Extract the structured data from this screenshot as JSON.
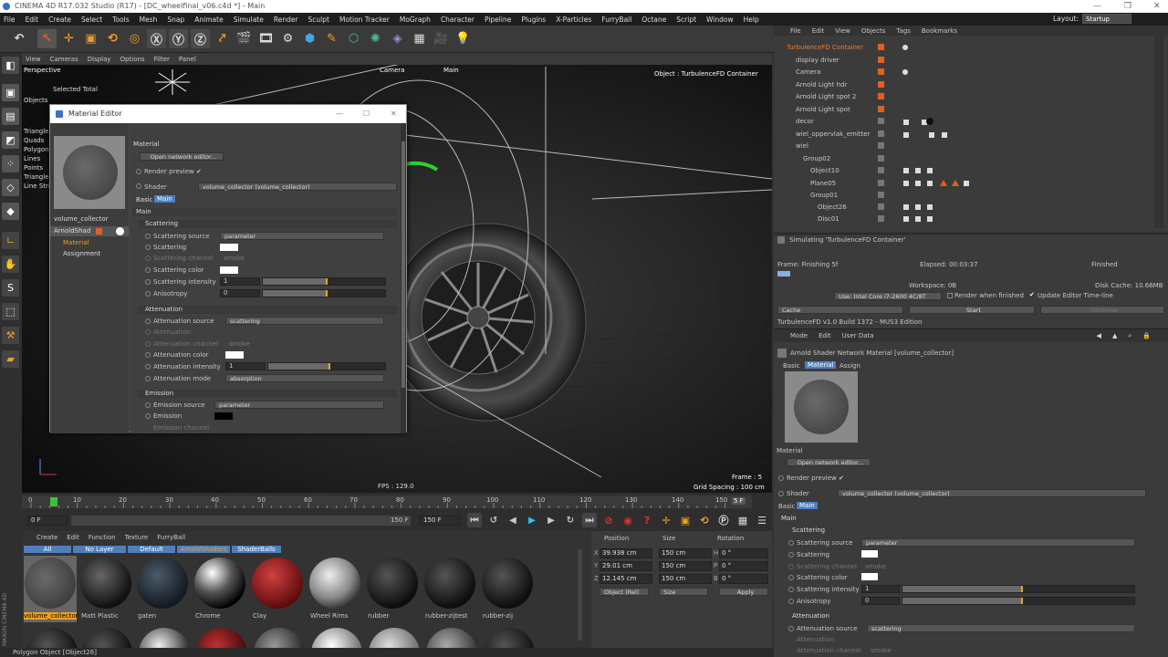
{
  "window": {
    "title": "CINEMA 4D R17.032 Studio (R17) - [DC_wheelfinal_v06.c4d *] - Main"
  },
  "menubar": [
    "File",
    "Edit",
    "Create",
    "Select",
    "Tools",
    "Mesh",
    "Snap",
    "Animate",
    "Simulate",
    "Render",
    "Sculpt",
    "Motion Tracker",
    "MoGraph",
    "Character",
    "Pipeline",
    "Plugins",
    "X-Particles",
    "FurryBall",
    "Octane",
    "Script",
    "Window",
    "Help"
  ],
  "layout": {
    "label": "Layout:",
    "value": "Startup"
  },
  "viewport": {
    "menu": [
      "View",
      "Cameras",
      "Display",
      "Options",
      "Filter",
      "Panel"
    ],
    "name": "Perspective",
    "camera": "Camera",
    "main_label": "Main",
    "object_label": "Object : TurbulenceFD Container",
    "fps": "FPS : 129.0",
    "frame": "Frame : 5",
    "grid": "Grid Spacing : 100 cm",
    "selected_total": "Selected Total",
    "objects_label": "Objects",
    "stats": [
      "Triangles",
      "Quads",
      "Polygons",
      "Lines",
      "Points",
      "Triangles",
      "Line Strips"
    ]
  },
  "mated": {
    "title": "Material Editor",
    "mat_name": "volume_collector",
    "channel_shader": "ArnoldShad",
    "channel_material": "Material",
    "channel_assign": "Assignment",
    "header": "Material",
    "open_network": "Open network editor...",
    "render_preview": "Render preview ✔",
    "shader_label": "Shader",
    "shader_value": "volume_collector (volume_collector)",
    "tab_basic": "Basic",
    "tab_main": "Main",
    "main_header": "Main",
    "scattering": {
      "title": "Scattering",
      "source_label": "Scattering source",
      "source_value": "parameter",
      "scattering_label": "Scattering",
      "channel_label": "Scattering channel",
      "channel_value": "smoke",
      "color_label": "Scattering color",
      "intensity_label": "Scattering intensity",
      "intensity_value": "1",
      "anisotropy_label": "Anisotropy",
      "anisotropy_value": "0"
    },
    "attenuation": {
      "title": "Attenuation",
      "source_label": "Attenuation source",
      "source_value": "scattering",
      "att_label": "Attenuation",
      "channel_label": "Attenuation channel",
      "channel_value": "smoke",
      "color_label": "Attenuation color",
      "intensity_label": "Attenuation intensity",
      "intensity_value": "1",
      "mode_label": "Attenuation mode",
      "mode_value": "absorption"
    },
    "emission": {
      "title": "Emission",
      "source_label": "Emission source",
      "source_value": "parameter",
      "emission_label": "Emission",
      "channel_label": "Emission channel"
    }
  },
  "objmgr": {
    "menu": [
      "File",
      "Edit",
      "View",
      "Objects",
      "Tags",
      "Bookmarks"
    ],
    "rows": [
      "TurbulenceFD Container",
      "display driver",
      "Camera",
      "Arnold Light hdr",
      "Arnold Light spot 2",
      "Arnold Light spot",
      "decor",
      "wiel_oppervlak_emitter",
      "wiel",
      "Group02",
      "Object10",
      "Plane05",
      "Group01",
      "Object26",
      "Disc01"
    ]
  },
  "sim": {
    "title": "Simulating 'TurbulenceFD Container'",
    "frame": "Frame: Finishing 5f",
    "elapsed": "Elapsed: 00:03:37",
    "finished": "Finished",
    "workspace": "Workspace: 0B",
    "disk_cache": "Disk Cache: 10.66MB",
    "cpu": "Use: Intel Core i7-2600 4C/8T",
    "render_when_finished": "Render when finished",
    "update_editor": "Update Editor Time-line",
    "cache": "Cache",
    "start": "Start",
    "continue": "Continue",
    "version": "TurbulenceFD v1.0 Build 1372 - MUS3 Edition"
  },
  "attr": {
    "menu": [
      "Mode",
      "Edit",
      "User Data"
    ],
    "title": "Arnold Shader Network Material [volume_collector]",
    "tabs": [
      "Basic",
      "Material",
      "Assign"
    ],
    "header": "Material",
    "open_network": "Open network editor...",
    "render_preview": "Render preview ✔",
    "shader_label": "Shader",
    "shader_value": "volume_collector (volume_collector)",
    "tab_basic": "Basic",
    "tab_main": "Main",
    "main_header": "Main",
    "scattering_title": "Scattering",
    "source_label": "Scattering source",
    "source_value": "parameter",
    "scattering_label": "Scattering",
    "channel_label": "Scattering channel",
    "channel_value": "smoke",
    "color_label": "Scattering color",
    "intensity_label": "Scattering intensity",
    "intensity_value": "1",
    "anisotropy_label": "Anisotropy",
    "anisotropy_value": "0",
    "attenuation_title": "Attenuation",
    "att_source_label": "Attenuation source",
    "att_source_value": "scattering",
    "att_label": "Attenuation",
    "att_channel_label": "Attenuation channel",
    "att_channel_value": "smoke"
  },
  "timeline": {
    "ticks": [
      "0",
      "10",
      "20",
      "30",
      "40",
      "50",
      "60",
      "70",
      "80",
      "90",
      "100",
      "110",
      "120",
      "130",
      "140",
      "150"
    ],
    "frame_badge": "5 F",
    "current": "0 F",
    "end1": "150 F",
    "end2": "150 F"
  },
  "matmgr": {
    "menu": [
      "Create",
      "Edit",
      "Function",
      "Texture",
      "FurryBall"
    ],
    "filters": [
      "All",
      "No Layer",
      "Default",
      "ArnoldShaders",
      "ShaderBalls"
    ],
    "materials": [
      "volume_collector",
      "Matt Plastic",
      "gaten",
      "Chrome",
      "Clay",
      "Wheel Rims",
      "rubber",
      "rubber-zijtest",
      "rubber-zij"
    ]
  },
  "coord": {
    "headers": [
      "Position",
      "Size",
      "Rotation"
    ],
    "x": "39.938 cm",
    "y": "29.01 cm",
    "z": "12.145 cm",
    "sx": "150 cm",
    "sy": "150 cm",
    "sz": "150 cm",
    "h": "0 °",
    "p": "0 °",
    "b": "0 °",
    "mode": "Object (Rel)",
    "size_mode": "Size",
    "apply": "Apply"
  },
  "status": "Polygon Object [Object26]"
}
